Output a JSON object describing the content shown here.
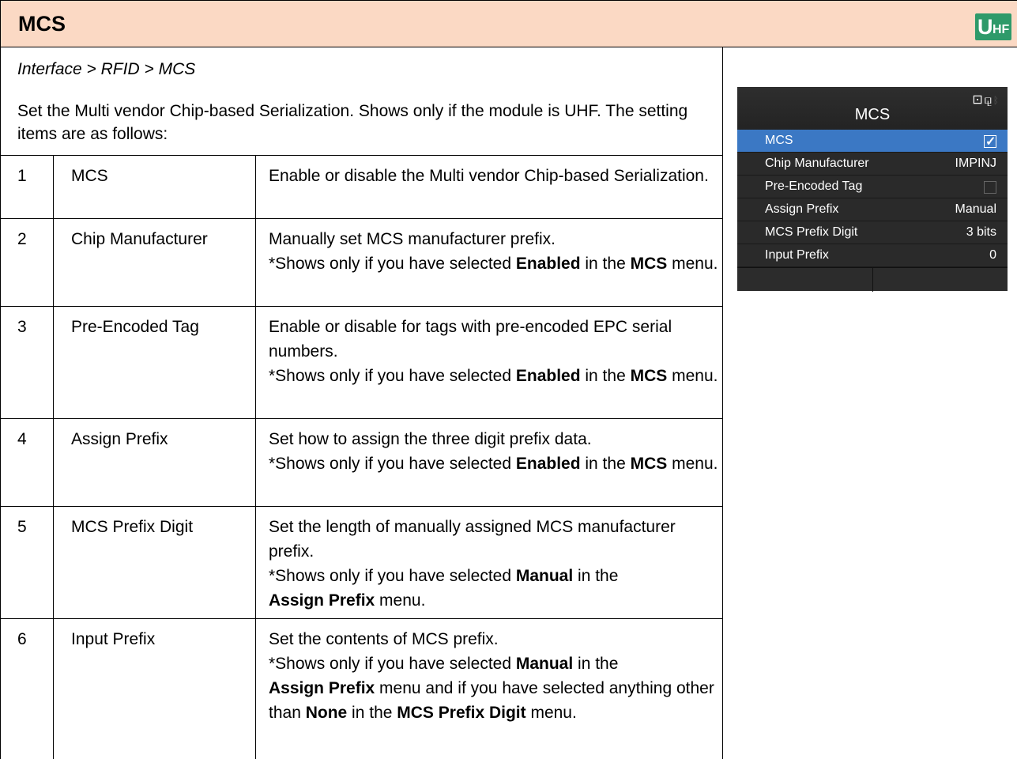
{
  "header": {
    "title": "MCS",
    "badge_u": "U",
    "badge_hf": "HF"
  },
  "breadcrumb": "Interface > RFID > MCS",
  "intro": "Set the Multi vendor Chip-based Serialization. Shows only if the module is UHF. The setting items are as follows:",
  "table": {
    "rows": [
      {
        "num": "1",
        "name": "MCS",
        "desc": "Enable or disable the Multi vendor Chip-based Serialization."
      },
      {
        "num": "2",
        "name": "Chip Manufacturer",
        "desc": "Manually set MCS manufacturer prefix.",
        "note_pre": "*Shows only if you have selected ",
        "note_bold1": "Enabled",
        "note_mid": " in the ",
        "note_bold2": "MCS",
        "note_post": " menu."
      },
      {
        "num": "3",
        "name": "Pre-Encoded Tag",
        "desc": "Enable or disable for tags with pre-encoded EPC serial numbers.",
        "note_pre": "*Shows only if you have selected ",
        "note_bold1": "Enabled",
        "note_mid": " in the ",
        "note_bold2": "MCS",
        "note_post": " menu."
      },
      {
        "num": "4",
        "name": "Assign Prefix",
        "desc": "Set how to assign the three digit prefix data.",
        "note_pre": "*Shows only if you have selected ",
        "note_bold1": "Enabled",
        "note_mid": " in the ",
        "note_bold2": "MCS",
        "note_post": " menu."
      },
      {
        "num": "5",
        "name": "MCS Prefix Digit",
        "desc": "Set the length of manually assigned MCS manufacturer prefix.",
        "note_pre": "*Shows only if you have selected ",
        "note_bold1": "Manual",
        "note_mid": " in the ",
        "note_bold2": "Assign Prefix",
        "note_post": " menu."
      },
      {
        "num": "6",
        "name": "Input Prefix",
        "desc": "Set the contents of MCS prefix.",
        "note_pre": "*Shows only if you have selected ",
        "note_bold1": "Manual",
        "note_mid": " in the ",
        "note_bold2": "Assign Prefix",
        "note_mid2": " menu and if you have selected anything other than ",
        "note_bold3": "None",
        "note_mid3": " in the ",
        "note_bold4": "MCS Prefix Digit",
        "note_post": " menu."
      }
    ]
  },
  "device": {
    "title": "MCS",
    "items": [
      {
        "label": "MCS",
        "value": "",
        "checkbox": true,
        "checked": true,
        "selected": true
      },
      {
        "label": "Chip Manufacturer",
        "value": "IMPINJ"
      },
      {
        "label": "Pre-Encoded Tag",
        "value": "",
        "checkbox": true,
        "checked": false
      },
      {
        "label": "Assign Prefix",
        "value": "Manual"
      },
      {
        "label": "MCS Prefix Digit",
        "value": "3 bits"
      },
      {
        "label": "Input Prefix",
        "value": "0"
      }
    ],
    "colors": {
      "selected": "#3b78c4",
      "background": "#2a2a2a"
    }
  },
  "colors": {
    "header_bg": "#fbd9c4",
    "badge_bg": "#2e9a6a"
  }
}
